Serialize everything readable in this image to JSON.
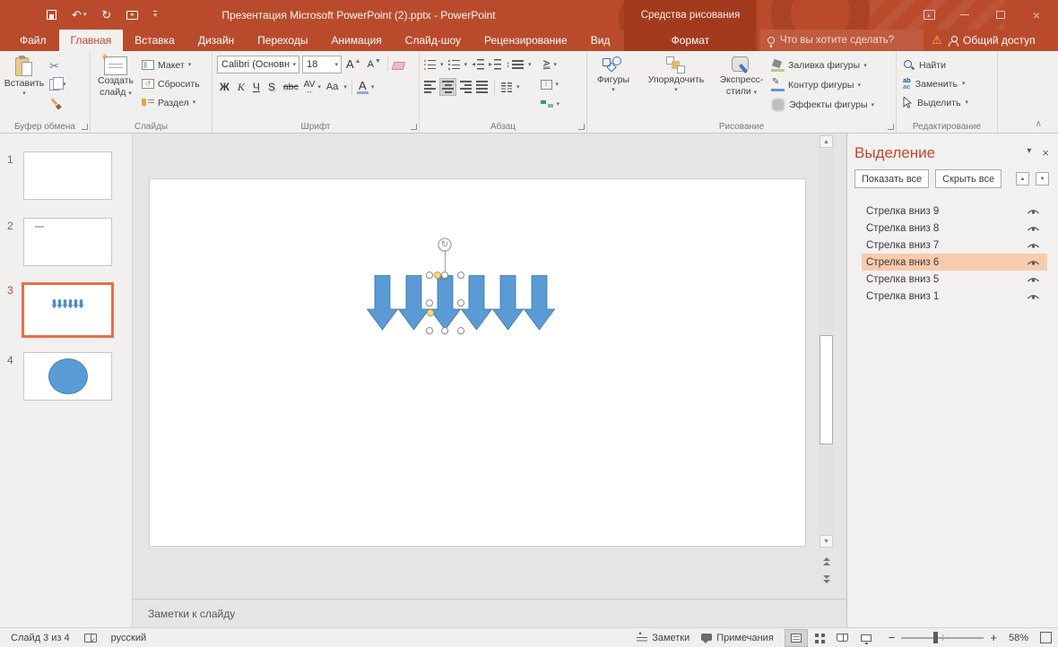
{
  "titlebar": {
    "title": "Презентация Microsoft PowerPoint (2).pptx - PowerPoint",
    "context_label": "Средства рисования"
  },
  "tabs": {
    "file": "Файл",
    "items": [
      "Главная",
      "Вставка",
      "Дизайн",
      "Переходы",
      "Анимация",
      "Слайд-шоу",
      "Рецензирование",
      "Вид"
    ],
    "context_tab": "Формат",
    "tellme": "Что вы хотите сделать?",
    "share": "Общий доступ"
  },
  "ribbon": {
    "clipboard": {
      "label": "Буфер обмена",
      "paste": "Вставить"
    },
    "slides": {
      "label": "Слайды",
      "new_slide_1": "Создать",
      "new_slide_2": "слайд",
      "layout": "Макет",
      "reset": "Сбросить",
      "section": "Раздел"
    },
    "font": {
      "label": "Шрифт",
      "family": "Calibri (Основн",
      "size": "18",
      "grow": "А",
      "shrink": "А",
      "bold": "Ж",
      "italic": "К",
      "underline": "Ч",
      "shadow": "S",
      "strikethrough": "abc",
      "spacing": "AV",
      "case": "Aa",
      "color": "А"
    },
    "paragraph": {
      "label": "Абзац"
    },
    "drawing": {
      "label": "Рисование",
      "shapes": "Фигуры",
      "arrange": "Упорядочить",
      "styles_1": "Экспресс-",
      "styles_2": "стили",
      "fill": "Заливка фигуры",
      "outline": "Контур фигуры",
      "effects": "Эффекты фигуры"
    },
    "editing": {
      "label": "Редактирование",
      "find": "Найти",
      "replace": "Заменить",
      "select": "Выделить"
    }
  },
  "slides_panel": {
    "thumbnails": [
      {
        "number": 1,
        "content": "blank"
      },
      {
        "number": 2,
        "content": "text"
      },
      {
        "number": 3,
        "content": "arrows",
        "selected": true
      },
      {
        "number": 4,
        "content": "circle"
      }
    ]
  },
  "canvas": {
    "arrow_count": 6,
    "selected_shape": "Стрелка вниз 6"
  },
  "notes": {
    "placeholder": "Заметки к слайду"
  },
  "selection_pane": {
    "title": "Выделение",
    "show_all": "Показать все",
    "hide_all": "Скрыть все",
    "items": [
      {
        "label": "Стрелка вниз 9",
        "visible": true
      },
      {
        "label": "Стрелка вниз 8",
        "visible": true
      },
      {
        "label": "Стрелка вниз 7",
        "visible": true
      },
      {
        "label": "Стрелка вниз 6",
        "visible": true,
        "selected": true
      },
      {
        "label": "Стрелка вниз 5",
        "visible": true
      },
      {
        "label": "Стрелка вниз 1",
        "visible": true
      }
    ]
  },
  "statusbar": {
    "slide_indicator": "Слайд 3 из 4",
    "language": "русский",
    "notes": "Заметки",
    "comments": "Примечания",
    "zoom": "58%"
  },
  "icons": {
    "dropdown": "▾",
    "undo": "↶",
    "redo": "↻",
    "rotate": "↻",
    "play": "▸",
    "reset_arrow": "↺",
    "updown": "↕",
    "minimize": "–",
    "close": "×",
    "warning": "⚠",
    "scissors": "✂",
    "collapse_ribbon": "∧",
    "pane_menu": "▾",
    "pane_close": "×",
    "up": "▲",
    "down": "▼",
    "zoom_out": "−",
    "zoom_in": "+",
    "fit_glyph": "✛"
  },
  "colors": {
    "titlebar": "#B94B2C",
    "context_dark": "#A23B1E",
    "ribbon_bg": "#F1F0EF",
    "shape_fill": "#5B9BD5",
    "shape_outline": "#41719C",
    "selected_slide_border": "#ED6C47",
    "selection_highlight": "#F8CBAD",
    "pane_title": "#C8432B"
  }
}
